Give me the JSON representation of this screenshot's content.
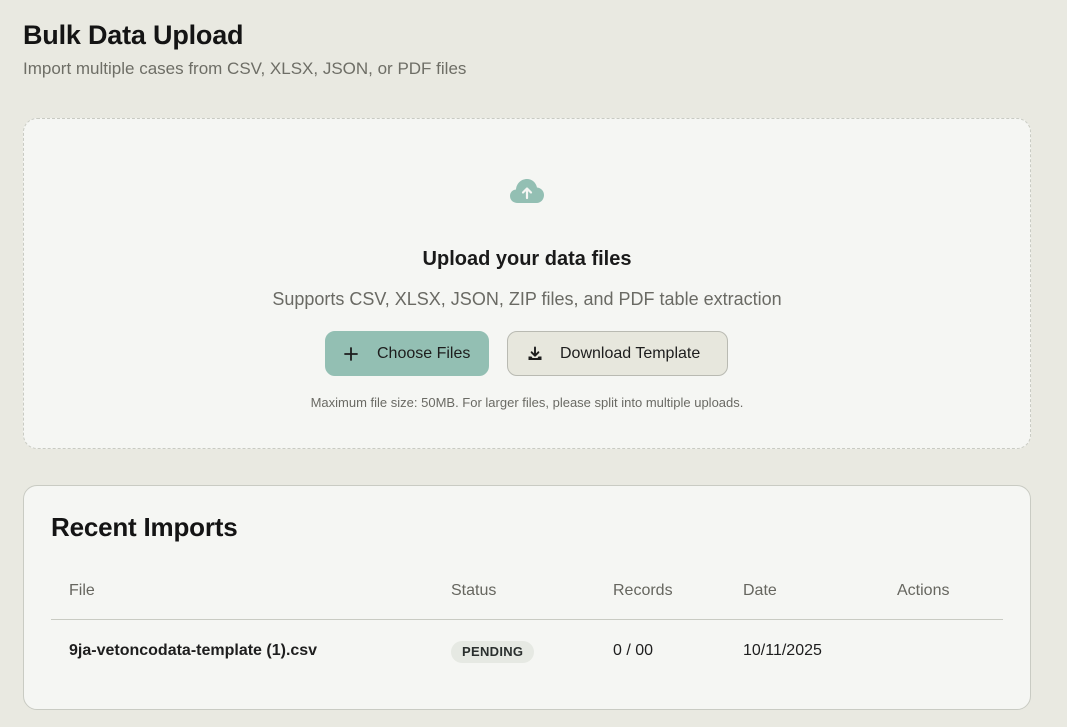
{
  "page": {
    "title": "Bulk Data Upload",
    "subtitle": "Import multiple cases from CSV, XLSX, JSON, or PDF files"
  },
  "upload": {
    "icon": "cloud-upload-icon",
    "heading": "Upload your data files",
    "description": "Supports CSV, XLSX, JSON, ZIP files, and PDF table extraction",
    "choose_label": "Choose Files",
    "choose_icon": "plus-icon",
    "template_label": "Download Template",
    "template_icon": "download-icon",
    "note": "Maximum file size: 50MB. For larger files, please split into multiple uploads."
  },
  "imports": {
    "title": "Recent Imports",
    "columns": [
      "File",
      "Status",
      "Records",
      "Date",
      "Actions"
    ],
    "rows": [
      {
        "file": "9ja-vetoncodata-template (1).csv",
        "status": "PENDING",
        "records": "0 / 00",
        "date": "10/11/2025",
        "actions": ""
      }
    ]
  },
  "colors": {
    "background": "#e9e9e1",
    "card": "#f5f6f3",
    "accent": "#93bfb3",
    "secondary_button": "#e7e7dd"
  }
}
